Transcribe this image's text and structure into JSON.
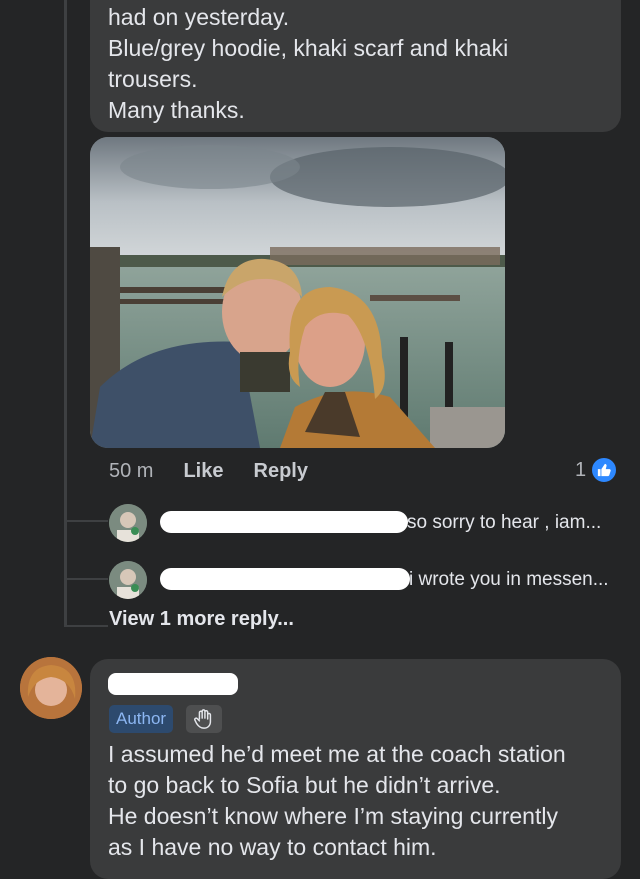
{
  "top_comment": {
    "lines": [
      "had on yesterday.",
      "Blue/grey hoodie, khaki scarf and khaki",
      "trousers.",
      "Many thanks."
    ]
  },
  "comment_actions": {
    "time": "50 m",
    "like_label": "Like",
    "reply_label": "Reply",
    "reaction_count": "1",
    "reaction_icon": "thumbs-up-icon"
  },
  "replies": [
    {
      "text": "so sorry to hear , iam..."
    },
    {
      "text": "i wrote you in messen..."
    }
  ],
  "view_more": "View 1 more reply...",
  "author_comment": {
    "badge": "Author",
    "badge_icon": "wave-icon",
    "lines": [
      "I assumed he’d meet me at the coach station",
      "to go back to Sofia but he didn’t arrive.",
      "He doesn’t know where I’m staying currently",
      "as I have no way to contact him."
    ]
  },
  "colors": {
    "background": "#242526",
    "bubble": "#3a3b3c",
    "like_blue": "#2d88ff",
    "author_badge_bg": "#2d4a6e",
    "author_badge_text": "#8cb6f2"
  }
}
